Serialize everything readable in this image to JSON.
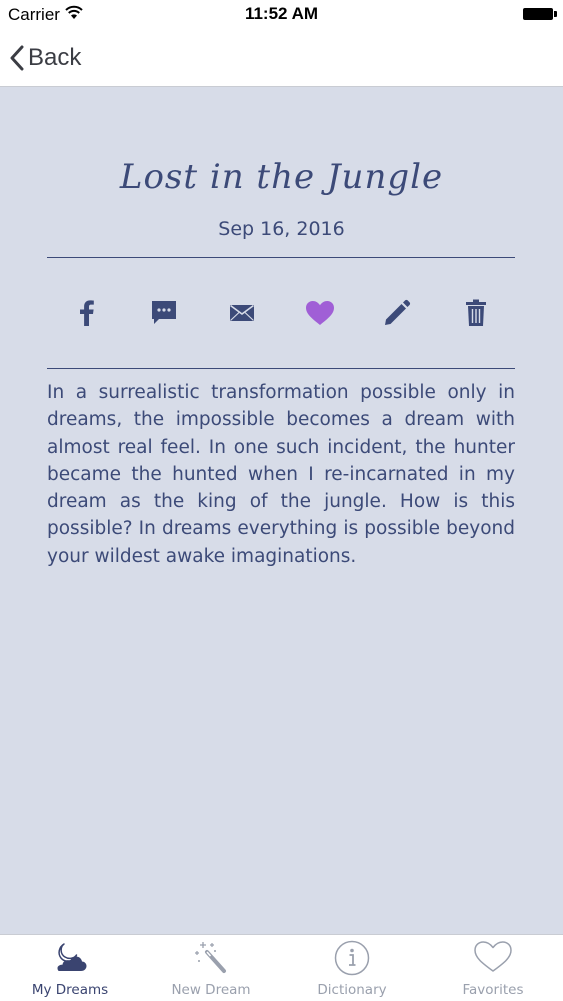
{
  "status_bar": {
    "carrier": "Carrier",
    "time": "11:52 AM"
  },
  "nav": {
    "back_label": "Back"
  },
  "dream": {
    "title": "Lost in the Jungle",
    "date": "Sep 16, 2016",
    "text": "In a surrealistic transformation possible only in dreams, the impossible becomes a dream with almost real feel. In one such incident, the hunter became the hunted when I re-incarnated in my dream as the king of the jungle. How is this possible? In dreams everything is possible beyond your wildest awake imaginations."
  },
  "actions": [
    {
      "icon": "facebook-icon"
    },
    {
      "icon": "message-icon"
    },
    {
      "icon": "mail-icon"
    },
    {
      "icon": "heart-icon",
      "active": true
    },
    {
      "icon": "pencil-icon"
    },
    {
      "icon": "trash-icon"
    }
  ],
  "tabs": [
    {
      "label": "My Dreams",
      "icon": "moon-cloud-icon",
      "active": true
    },
    {
      "label": "New Dream",
      "icon": "magic-wand-icon",
      "active": false
    },
    {
      "label": "Dictionary",
      "icon": "info-icon",
      "active": false
    },
    {
      "label": "Favorites",
      "icon": "heart-outline-icon",
      "active": false
    }
  ],
  "colors": {
    "background": "#d7dce8",
    "text": "#3c4a78",
    "favorite": "#a05fd6",
    "tab_active": "#3a4470",
    "tab_inactive": "#9aa0ad"
  }
}
